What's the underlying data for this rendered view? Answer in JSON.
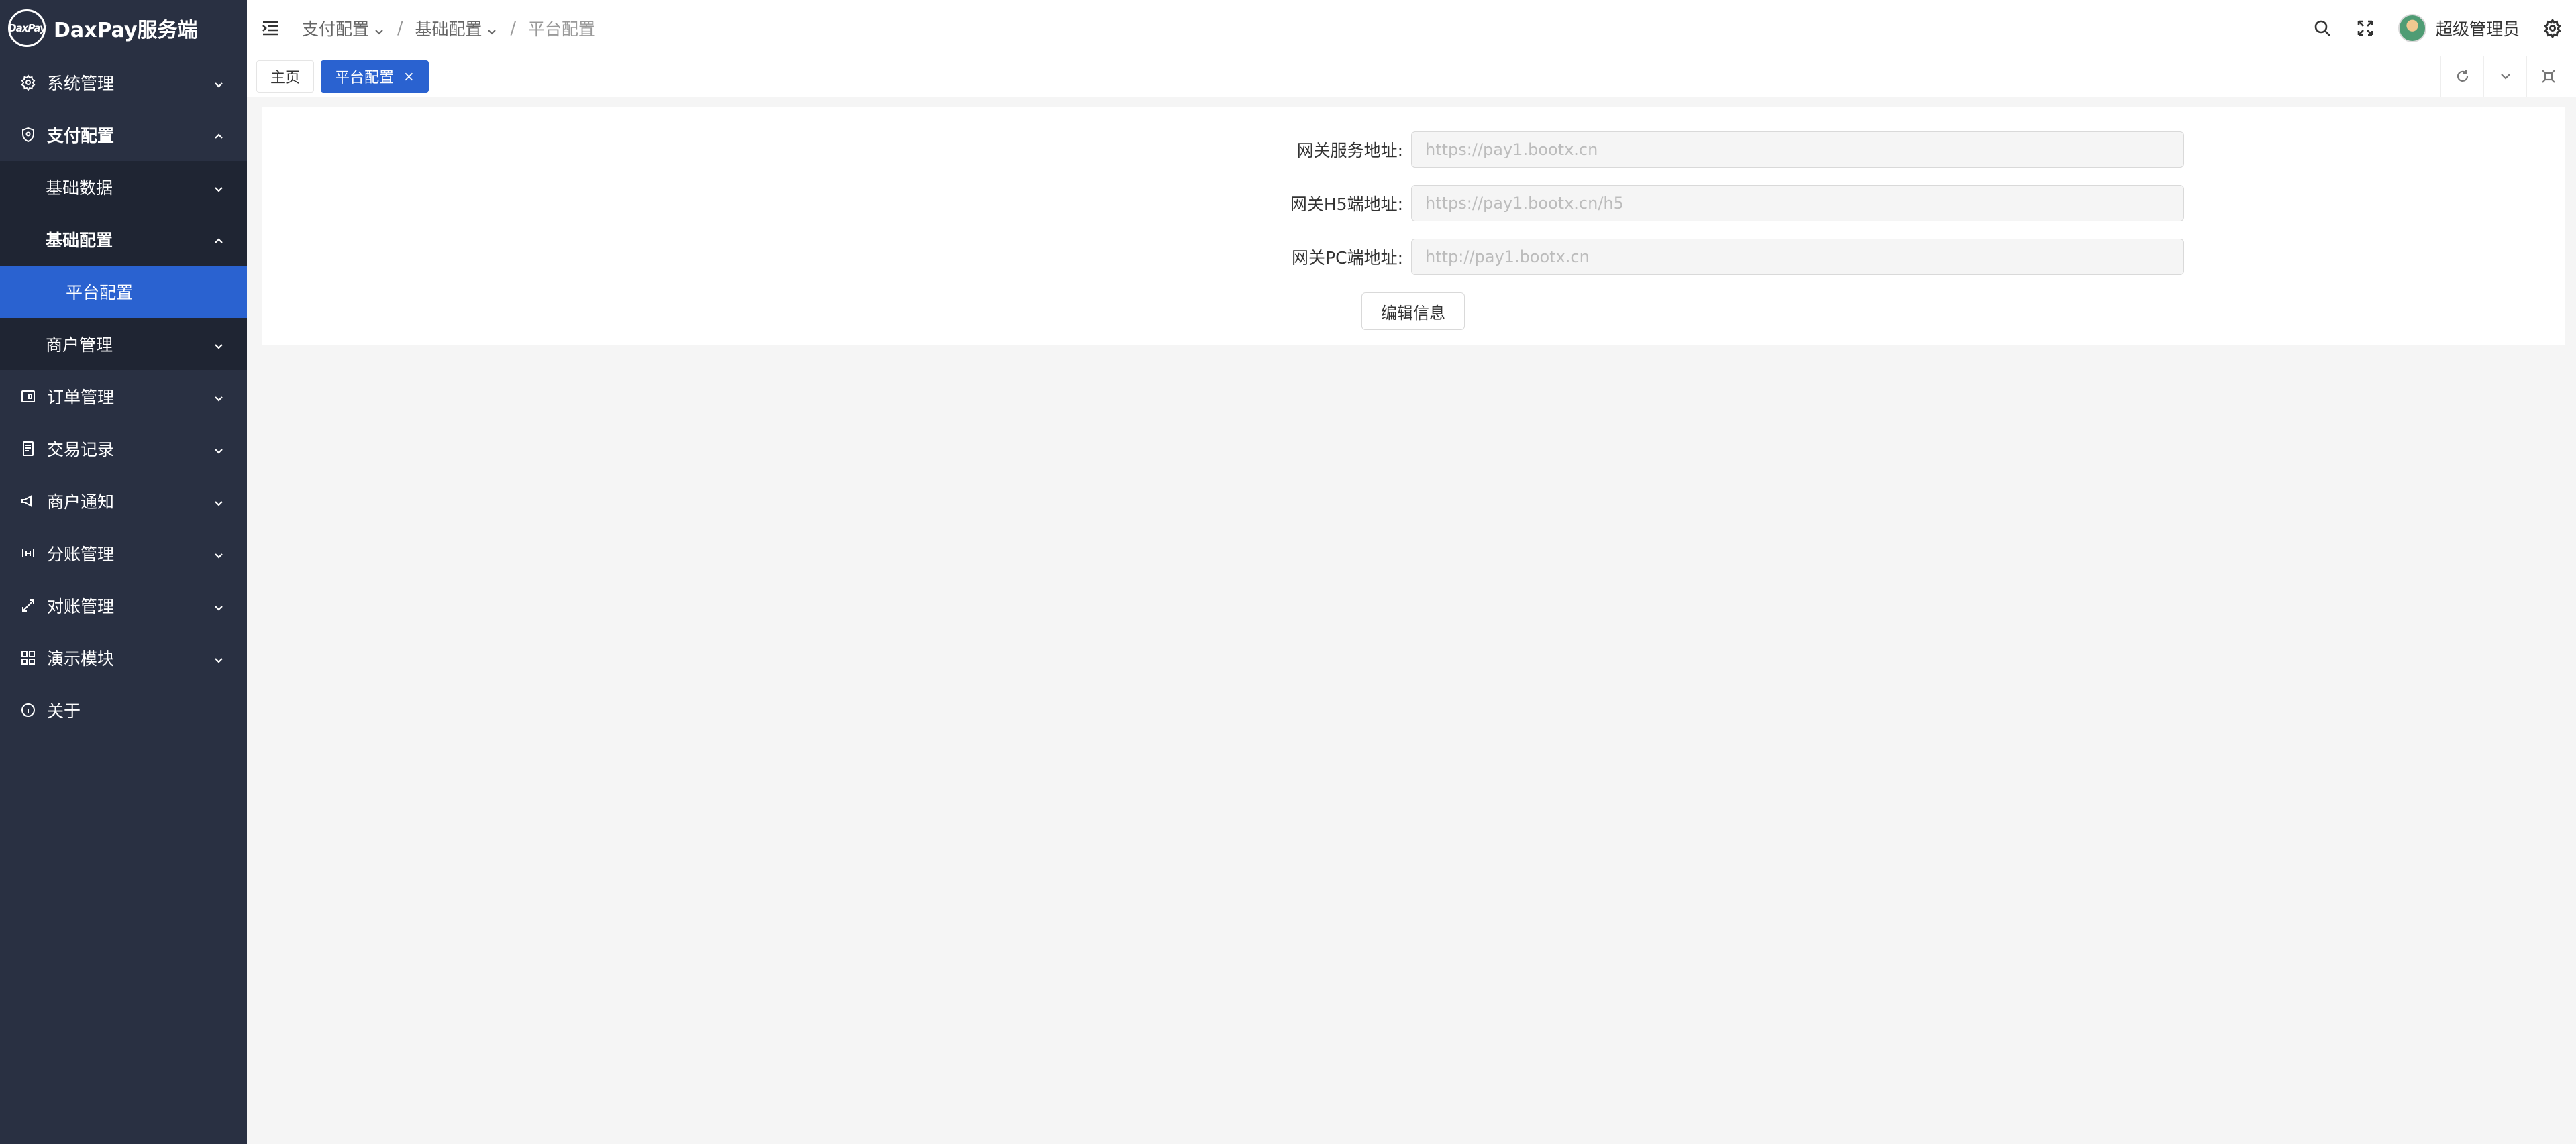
{
  "app": {
    "logo_text": "DaxPay",
    "title": "DaxPay服务端"
  },
  "sidebar": {
    "items": [
      {
        "label": "系统管理",
        "icon": "gear-icon"
      },
      {
        "label": "支付配置",
        "icon": "shield-icon"
      },
      {
        "label": "基础数据"
      },
      {
        "label": "基础配置"
      },
      {
        "label": "平台配置"
      },
      {
        "label": "商户管理"
      },
      {
        "label": "订单管理",
        "icon": "order-icon"
      },
      {
        "label": "交易记录",
        "icon": "record-icon"
      },
      {
        "label": "商户通知",
        "icon": "megaphone-icon"
      },
      {
        "label": "分账管理",
        "icon": "split-icon"
      },
      {
        "label": "对账管理",
        "icon": "reconcile-icon"
      },
      {
        "label": "演示模块",
        "icon": "grid-icon"
      },
      {
        "label": "关于",
        "icon": "info-icon"
      }
    ]
  },
  "header": {
    "breadcrumb": [
      "支付配置",
      "基础配置",
      "平台配置"
    ],
    "username": "超级管理员"
  },
  "tabs": [
    {
      "label": "主页"
    },
    {
      "label": "平台配置",
      "close": "×"
    }
  ],
  "form": {
    "fields": [
      {
        "label": "网关服务地址:",
        "placeholder": "https://pay1.bootx.cn"
      },
      {
        "label": "网关H5端地址:",
        "placeholder": "https://pay1.bootx.cn/h5"
      },
      {
        "label": "网关PC端地址:",
        "placeholder": "http://pay1.bootx.cn"
      }
    ],
    "edit_button": "编辑信息"
  },
  "colors": {
    "sidebar_bg": "#293042",
    "accent": "#2a62d0"
  }
}
